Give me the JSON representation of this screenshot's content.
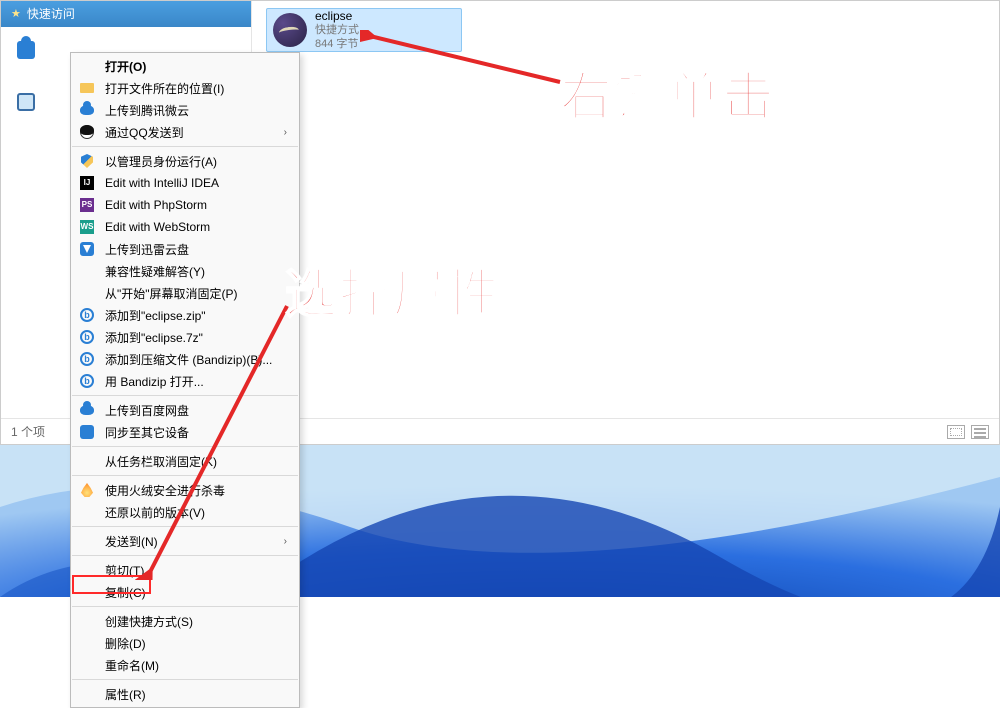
{
  "sidebar": {
    "quick_access": "快速访问"
  },
  "file": {
    "name": "eclipse",
    "type": "快捷方式",
    "size": "844 字节"
  },
  "statusbar": {
    "count": "1 个项"
  },
  "context_menu": {
    "items": [
      {
        "label": "打开(O)",
        "bold": true,
        "icon": "",
        "sub": false
      },
      {
        "label": "打开文件所在的位置(I)",
        "icon": "folder",
        "sub": false
      },
      {
        "label": "上传到腾讯微云",
        "icon": "tcloud",
        "sub": false
      },
      {
        "label": "通过QQ发送到",
        "icon": "qq",
        "sub": true
      },
      {
        "sep": true
      },
      {
        "label": "以管理员身份运行(A)",
        "icon": "shield",
        "sub": false
      },
      {
        "label": "Edit with IntelliJ IDEA",
        "icon": "ij",
        "icon_text": "IJ",
        "sub": false
      },
      {
        "label": "Edit with PhpStorm",
        "icon": "ps",
        "icon_text": "PS",
        "sub": false
      },
      {
        "label": "Edit with WebStorm",
        "icon": "ws",
        "icon_text": "WS",
        "sub": false
      },
      {
        "label": "上传到迅雷云盘",
        "icon": "xl",
        "sub": false
      },
      {
        "label": "兼容性疑难解答(Y)",
        "icon": "",
        "sub": false
      },
      {
        "label": "从\"开始\"屏幕取消固定(P)",
        "icon": "",
        "sub": false
      },
      {
        "label": "添加到\"eclipse.zip\"",
        "icon": "bz",
        "sub": false
      },
      {
        "label": "添加到\"eclipse.7z\"",
        "icon": "bz",
        "sub": false
      },
      {
        "label": "添加到压缩文件 (Bandizip)(B)...",
        "icon": "bz",
        "sub": false
      },
      {
        "label": "用 Bandizip 打开...",
        "icon": "bz",
        "sub": false
      },
      {
        "sep": true
      },
      {
        "label": "上传到百度网盘",
        "icon": "baidu",
        "sub": false
      },
      {
        "label": "同步至其它设备",
        "icon": "sync",
        "sub": false
      },
      {
        "sep": true
      },
      {
        "label": "从任务栏取消固定(K)",
        "icon": "",
        "sub": false
      },
      {
        "sep": true
      },
      {
        "label": "使用火绒安全进行杀毒",
        "icon": "fire",
        "sub": false
      },
      {
        "label": "还原以前的版本(V)",
        "icon": "",
        "sub": false
      },
      {
        "sep": true
      },
      {
        "label": "发送到(N)",
        "icon": "",
        "sub": true
      },
      {
        "sep": true
      },
      {
        "label": "剪切(T)",
        "icon": "",
        "sub": false
      },
      {
        "label": "复制(C)",
        "icon": "",
        "sub": false
      },
      {
        "sep": true
      },
      {
        "label": "创建快捷方式(S)",
        "icon": "",
        "sub": false
      },
      {
        "label": "删除(D)",
        "icon": "",
        "sub": false
      },
      {
        "label": "重命名(M)",
        "icon": "",
        "sub": false
      },
      {
        "sep": true
      },
      {
        "label": "属性(R)",
        "icon": "",
        "sub": false
      }
    ]
  },
  "annotations": {
    "a1": "右键单击",
    "a2": "选择属性"
  }
}
